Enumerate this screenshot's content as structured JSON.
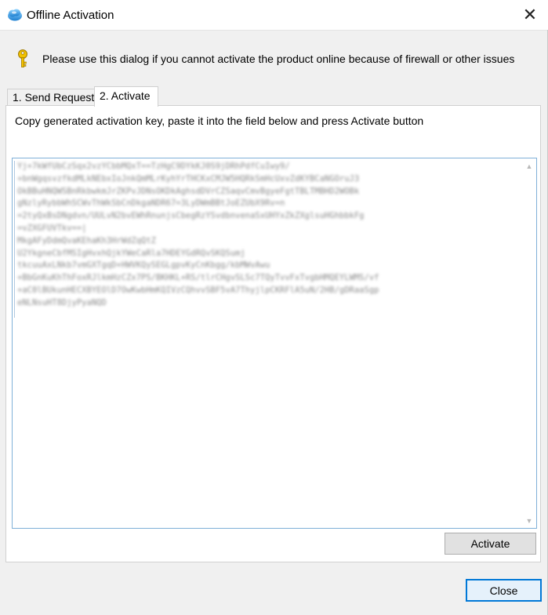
{
  "window": {
    "title": "Offline Activation",
    "close_glyph": "✕"
  },
  "info": {
    "message": "Please use this dialog if you cannot activate the product online because of firewall or other issues"
  },
  "tabs": [
    {
      "label": "1. Send Request",
      "active": false
    },
    {
      "label": "2. Activate",
      "active": true
    }
  ],
  "panel": {
    "instructions": "Copy generated activation key, paste it into the field below and press Activate button",
    "activation_key": "Yj+7kWfUbCzSqx2vzYCbbMQxT==TzHgC9DYkKJ0S9jDRhPdfCuIwy9/\n+bnWgqsvzfkdMLkNEbxIoJnkQmMLrKyhYrTHCKxCMJW5HQRkSmHcUxvZdKYBCaNGOruJ3\nOkBBuHNQWSBnRkbwkmJrZKPvJDNsOKDkAghsdDVrCZSaqvCmvBgyeFgtTBLTMBHD2WOBk\ngNzlyRybbWhSCWvThWkSbCnDkgaNDR67=3LyDWmBBtJoEZUbX9Rv=n\n=2tyQxBsDNgdvn/UULvN2bvEWhRnunjsCbegRzYSvdbnvenaSxUHYxZkZXglsuHGhbbkFg\n=vZXGFUVTkv==|\nMkgAFyDdmQvaKEhaKh3HrWdZqQtZ\nU2YkgneCbfMSIgHvxhQjkYWeCaRla7HDEYGdRQvSKQSumj\ntkcuuAxLNkb7vmGXTgqD+HWVKQySEGLgpvKyCnKbgg/kbMWvAwu\n+BbGnKuKhThFoxRJlkmHzCZx7PS/BKHKL+RS/tlrCHgvSLSc7TQyTvvFxTvgbHMQEYLWMS/vf\n+aC0lBUkunHECXBYEOlD7OwKwbHmKQIVzCQhvvSBF5vA7ThyjlpCKRFlA5uN/2HB/gDRaaSgp\neNLNsuHT8DjyPyaNQD"
  },
  "buttons": {
    "activate": "Activate",
    "close": "Close"
  },
  "icons": {
    "app": "cloud-icon",
    "info": "key-icon"
  },
  "colors": {
    "focus_border": "#0078d7",
    "field_border": "#7fb0d8",
    "key_yellow": "#f2c200"
  }
}
